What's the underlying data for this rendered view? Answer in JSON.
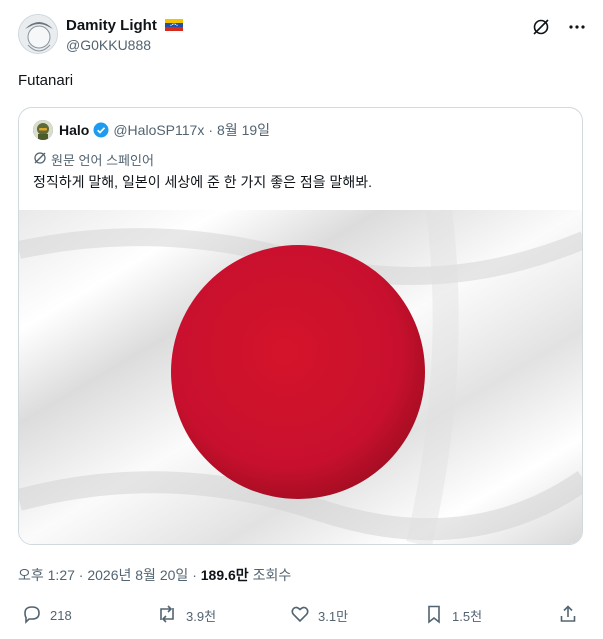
{
  "author": {
    "name": "Damity Light",
    "handle": "@G0KKU888",
    "flag": "venezuela-flag"
  },
  "post": {
    "text": "Futanari"
  },
  "quote": {
    "name": "Halo",
    "handle": "@HaloSP117x",
    "separator": "·",
    "date": "8월 19일",
    "translate_label": "원문 언어 스페인어",
    "text": "정직하게 말해, 일본이 세상에 준 한 가지 좋은 점을 말해봐.",
    "image": "japanese-flag"
  },
  "meta": {
    "time": "오후 1:27",
    "sep1": "·",
    "date": "2026년 8월 20일",
    "sep2": "·",
    "views": "189.6만",
    "views_label": "조회수"
  },
  "actions": {
    "replies": "218",
    "reposts": "3.9천",
    "likes": "3.1만",
    "bookmarks": "1.5천"
  },
  "colors": {
    "flag_red": "#c8102e",
    "verified": "#1d9bf0",
    "muted": "#536471"
  }
}
